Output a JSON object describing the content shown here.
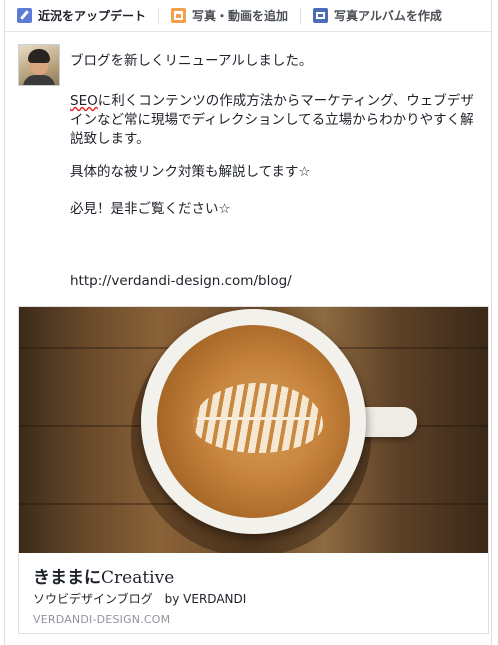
{
  "composer": {
    "tabs": [
      {
        "label": "近況をアップデート",
        "icon": "pencil-icon"
      },
      {
        "label": "写真・動画を追加",
        "icon": "photo-icon"
      },
      {
        "label": "写真アルバムを作成",
        "icon": "album-icon"
      }
    ]
  },
  "post": {
    "line1": "ブログを新しくリニューアルしました。",
    "para2_seo": "SEO",
    "para2_rest": "に利くコンテンツの作成方法からマーケティング、ウェブデザインなど常に現場でディレクションしてる立場からわかりやすく解説致します。",
    "line3": "具体的な被リンク対策も解説してます☆",
    "line4": "必見！是非ご覧ください☆",
    "url": "http://verdandi-design.com/blog/"
  },
  "link_card": {
    "image_alt": "latte-art-coffee-cup",
    "title_jp": "きままに",
    "title_en": "Creative",
    "description": "ソウビデザインブログ　by VERDANDI",
    "domain": "VERDANDI-DESIGN.COM"
  },
  "colors": {
    "tab_text": "#4b4f56",
    "body_text": "#1d2129",
    "muted": "#90949c",
    "border": "#dddfe2"
  }
}
